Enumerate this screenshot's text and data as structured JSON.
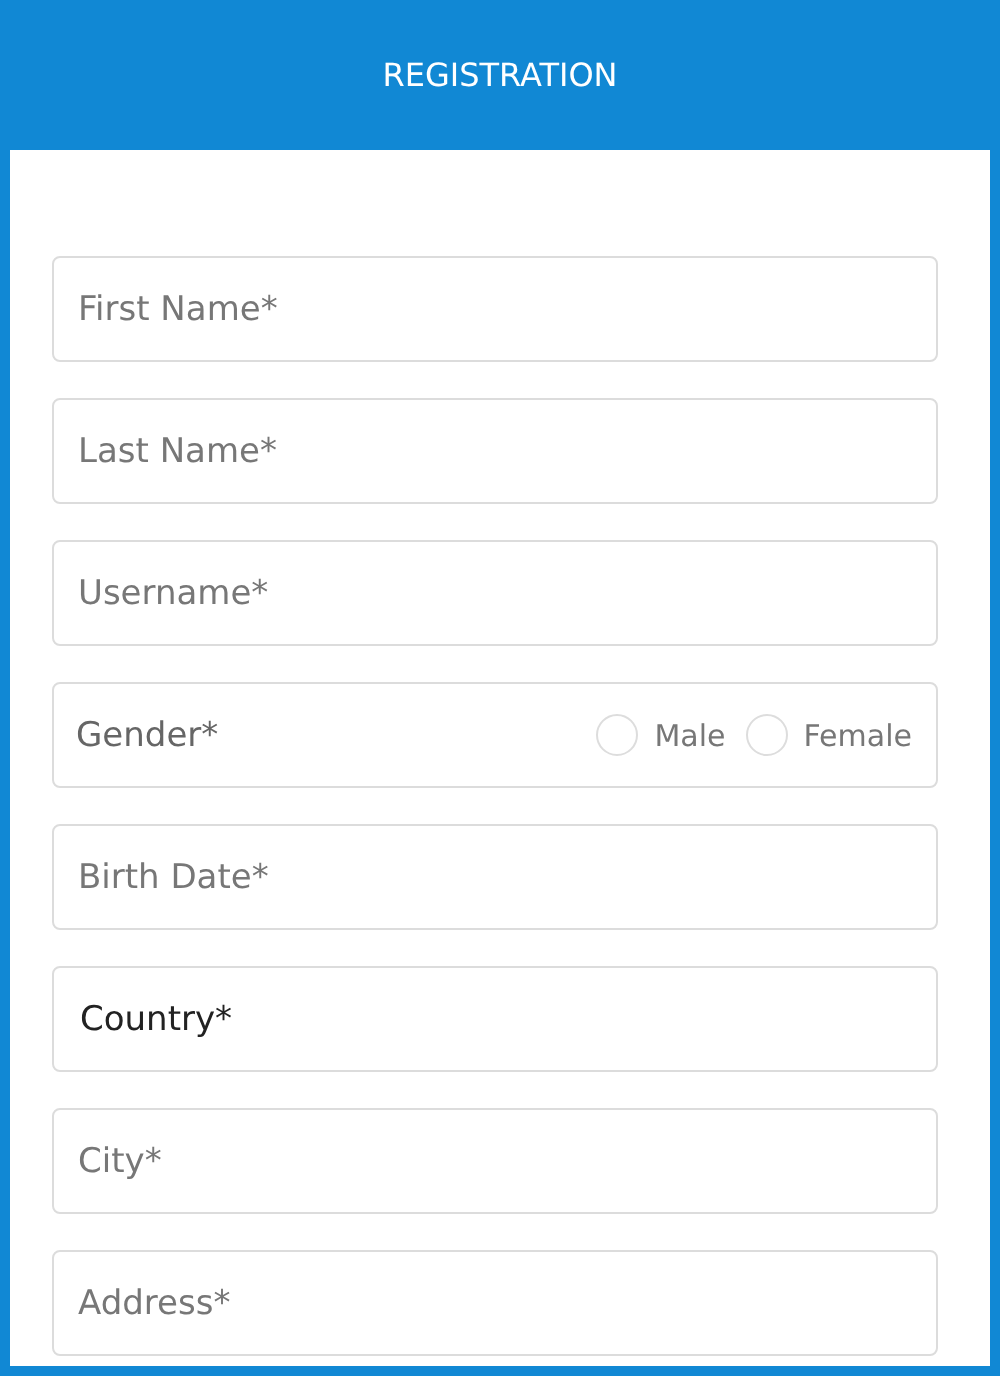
{
  "header": {
    "title": "REGISTRATION"
  },
  "fields": [
    {
      "kind": "text",
      "placeholder": "First Name*"
    },
    {
      "kind": "text",
      "placeholder": "Last Name*"
    },
    {
      "kind": "text",
      "placeholder": "Username*"
    },
    {
      "kind": "radio",
      "label": "Gender*",
      "options": [
        {
          "label": "Male",
          "selected": false
        },
        {
          "label": "Female",
          "selected": false
        }
      ]
    },
    {
      "kind": "text",
      "placeholder": "Birth Date*"
    },
    {
      "kind": "select",
      "value": "Country*"
    },
    {
      "kind": "text",
      "placeholder": "City*"
    },
    {
      "kind": "text",
      "placeholder": "Address*"
    }
  ]
}
